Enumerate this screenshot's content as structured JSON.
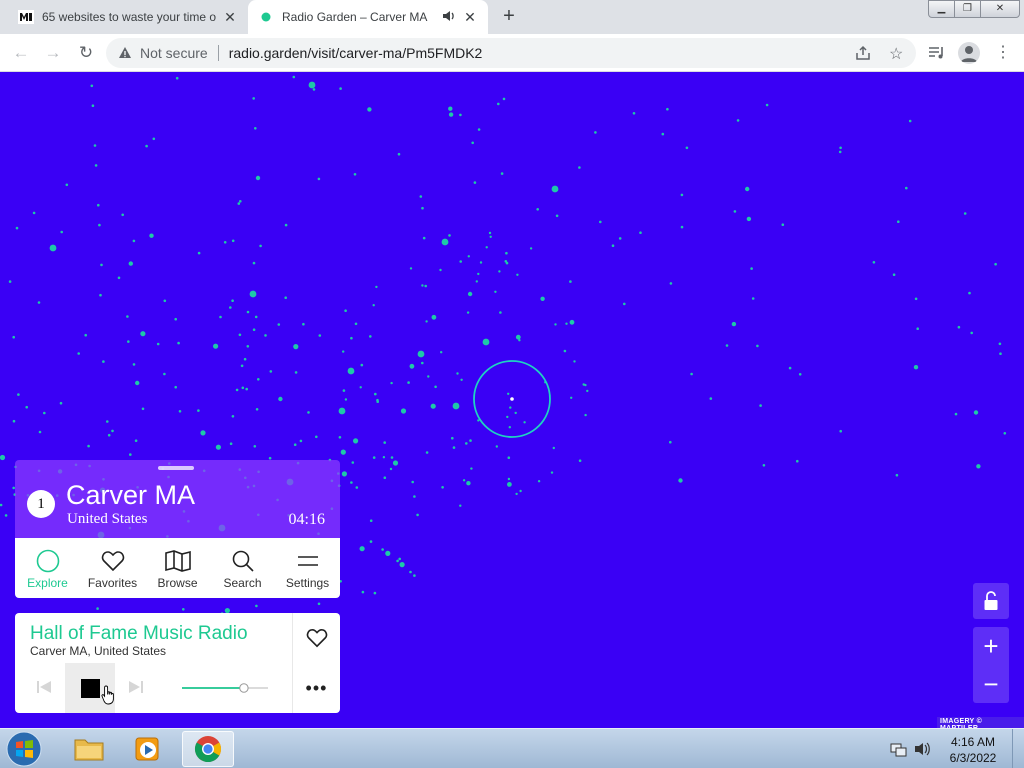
{
  "browser": {
    "tabs": [
      {
        "title": "65 websites to waste your time o",
        "favicon": "medium-icon",
        "active": false
      },
      {
        "title": "Radio Garden – Carver MA",
        "favicon": "green-dot-icon",
        "active": true,
        "playing_audio": true
      }
    ],
    "security_label": "Not secure",
    "url": "radio.garden/visit/carver-ma/Pm5FMDK2"
  },
  "station": {
    "count": "1",
    "place": "Carver MA",
    "country": "United States",
    "local_time": "04:16"
  },
  "nav": [
    {
      "label": "Explore",
      "icon": "explore-icon",
      "active": true
    },
    {
      "label": "Favorites",
      "icon": "heart-icon",
      "active": false
    },
    {
      "label": "Browse",
      "icon": "map-icon",
      "active": false
    },
    {
      "label": "Search",
      "icon": "search-icon",
      "active": false
    },
    {
      "label": "Settings",
      "icon": "menu-icon",
      "active": false
    }
  ],
  "player": {
    "station_name": "Hall of Fame Music Radio",
    "location": "Carver MA, United States",
    "volume_fraction": 0.72,
    "state": "playing"
  },
  "map": {
    "attribution": "IMAGERY © MAPTILER",
    "background_color": "#3a00f5",
    "marker_color": "#1ec9a8"
  },
  "taskbar": {
    "time": "4:16 AM",
    "date": "6/3/2022"
  }
}
